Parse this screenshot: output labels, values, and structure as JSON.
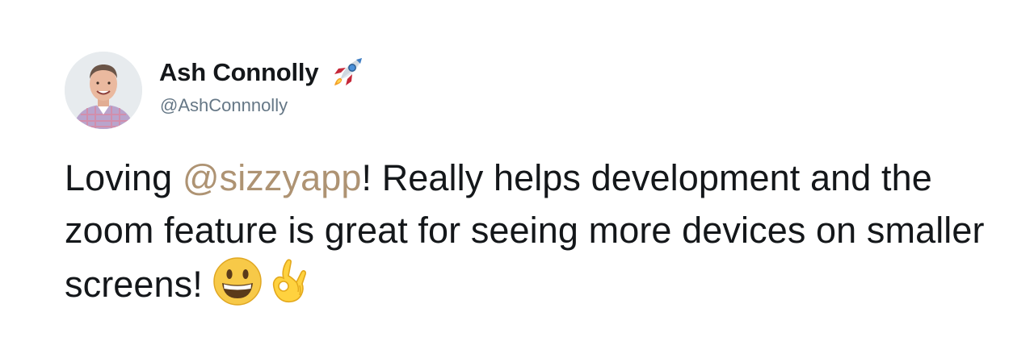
{
  "tweet": {
    "author": {
      "name": "Ash Connolly",
      "handle": "@AshConnnolly",
      "name_emoji": "rocket-icon",
      "avatar": "avatar"
    },
    "text": {
      "part1": "Loving ",
      "mention": "@sizzyapp",
      "part2": "! Really helps development and the zoom feature is great for seeing more devices on smaller screens! ",
      "emojis": [
        "grinning-face-icon",
        "ok-hand-icon"
      ]
    },
    "colors": {
      "text": "#14171a",
      "handle": "#657786",
      "mention": "#ae9373"
    }
  }
}
